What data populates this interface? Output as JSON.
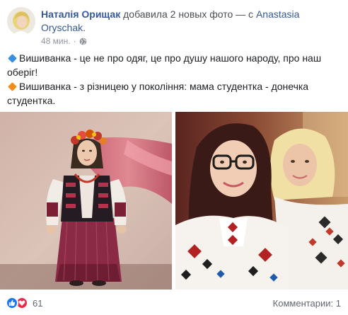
{
  "post": {
    "author": "Наталія Орищак",
    "action": " добавила 2 новых фото — с ",
    "tagged": "Anastasia Oryschak",
    "end": ".",
    "time": "48 мин.",
    "lines": [
      "Вишиванка - це не про одяг, це про душу нашого народу, про наш оберіг!",
      "Вишиванка - з різницею у покоління: мама студентка - донечка студентка."
    ]
  },
  "photos": [
    {
      "name": "photo-vintage-embroidered-costume"
    },
    {
      "name": "photo-mother-daughter-selfie"
    }
  ],
  "footer": {
    "reaction_count": "61",
    "comments": "Комментарии: 1"
  },
  "icons": {
    "globe": "globe-icon",
    "like": "like-reaction-icon",
    "love": "love-reaction-icon"
  },
  "colors": {
    "link": "#365899",
    "meta": "#90949c",
    "like": "#1877f2",
    "love": "#f0284a"
  }
}
